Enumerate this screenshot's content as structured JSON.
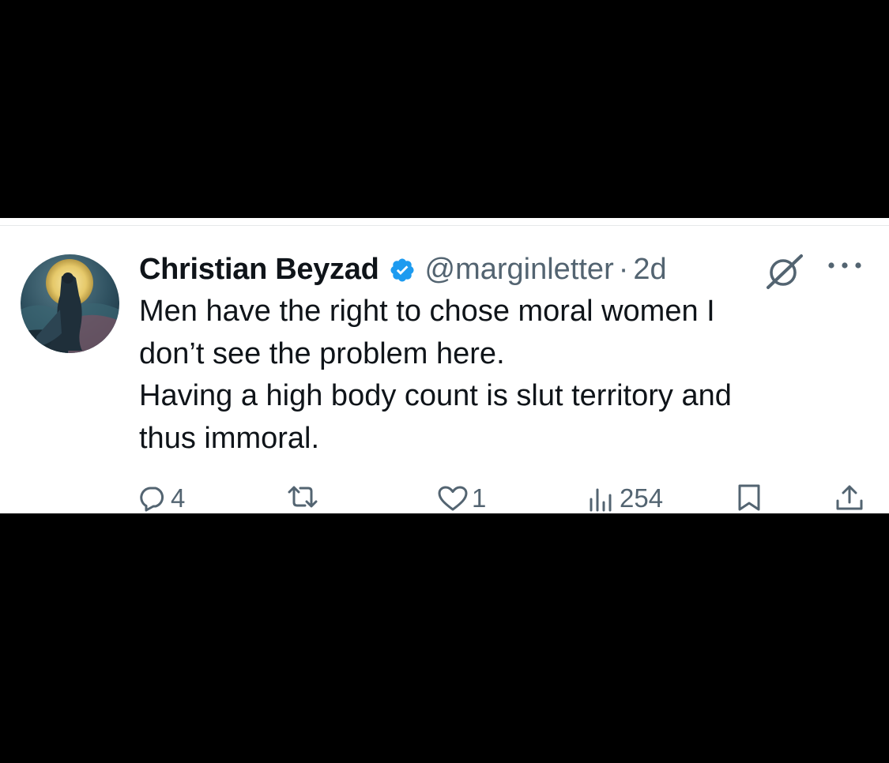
{
  "tweet": {
    "author": {
      "display_name": "Christian Beyzad",
      "handle": "@marginletter",
      "verified": true
    },
    "separator": "·",
    "time": "2d",
    "text_lines": [
      "Men have the right to chose moral women I",
      "don’t see the problem here.",
      "Having a high body count is slut territory and",
      "thus immoral."
    ],
    "actions": {
      "replies": "4",
      "reposts": "",
      "likes": "1",
      "views": "254"
    }
  },
  "colors": {
    "text_primary": "#0f1419",
    "text_secondary": "#536471",
    "verified_blue": "#1d9bf0",
    "background": "#ffffff",
    "letterbox": "#000000"
  },
  "icons": [
    "verified-badge-icon",
    "grok-icon",
    "more-icon",
    "reply-icon",
    "repost-icon",
    "like-icon",
    "views-icon",
    "bookmark-icon",
    "share-icon"
  ]
}
